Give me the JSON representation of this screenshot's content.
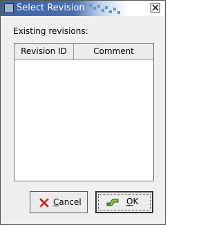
{
  "window": {
    "title": "Select Revision"
  },
  "main": {
    "label": "Existing revisions:",
    "columns": [
      "Revision ID",
      "Comment"
    ],
    "rows": []
  },
  "buttons": {
    "cancel_label": "Cancel",
    "ok_label": "OK"
  },
  "icons": {
    "window": "window-icon",
    "close": "close-icon",
    "cancel": "cancel-x-icon",
    "ok": "ok-check-icon"
  }
}
